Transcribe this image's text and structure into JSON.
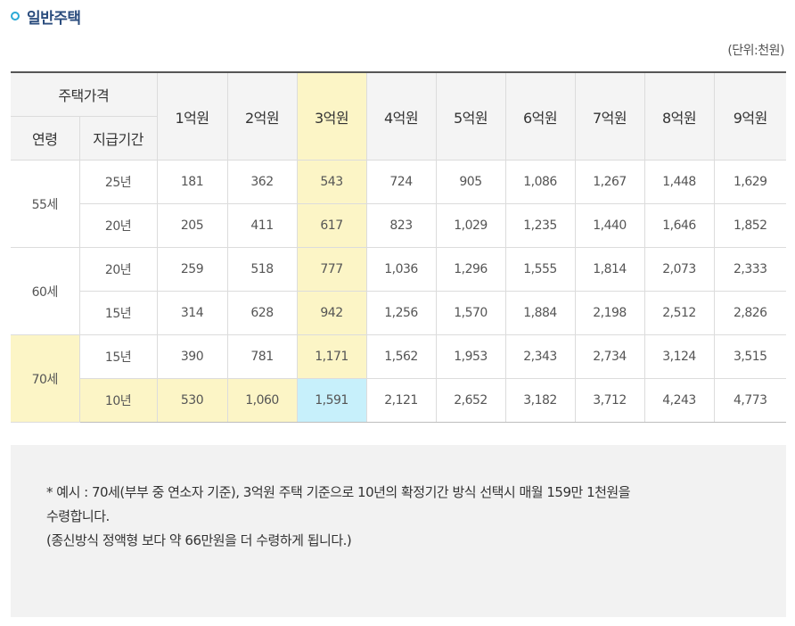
{
  "section": {
    "title": "일반주택",
    "unit": "(단위:천원)"
  },
  "table": {
    "header_price": "주택가격",
    "header_age": "연령",
    "header_period": "지급기간",
    "price_columns": [
      "1억원",
      "2억원",
      "3억원",
      "4억원",
      "5억원",
      "6억원",
      "7억원",
      "8억원",
      "9억원"
    ],
    "age_groups": [
      {
        "age": "55세",
        "rows": [
          {
            "period": "25년",
            "values": [
              "181",
              "362",
              "543",
              "724",
              "905",
              "1,086",
              "1,267",
              "1,448",
              "1,629"
            ]
          },
          {
            "period": "20년",
            "values": [
              "205",
              "411",
              "617",
              "823",
              "1,029",
              "1,235",
              "1,440",
              "1,646",
              "1,852"
            ]
          }
        ]
      },
      {
        "age": "60세",
        "rows": [
          {
            "period": "20년",
            "values": [
              "259",
              "518",
              "777",
              "1,036",
              "1,296",
              "1,555",
              "1,814",
              "2,073",
              "2,333"
            ]
          },
          {
            "period": "15년",
            "values": [
              "314",
              "628",
              "942",
              "1,256",
              "1,570",
              "1,884",
              "2,198",
              "2,512",
              "2,826"
            ]
          }
        ]
      },
      {
        "age": "70세",
        "rows": [
          {
            "period": "15년",
            "values": [
              "390",
              "781",
              "1,171",
              "1,562",
              "1,953",
              "2,343",
              "2,734",
              "3,124",
              "3,515"
            ]
          },
          {
            "period": "10년",
            "values": [
              "530",
              "1,060",
              "1,591",
              "2,121",
              "2,652",
              "3,182",
              "3,712",
              "4,243",
              "4,773"
            ]
          }
        ]
      }
    ]
  },
  "note": {
    "line1": "* 예시 : 70세(부부 중 연소자 기준), 3억원 주택 기준으로 10년의 확정기간 방식 선택시 매월 159만 1천원을",
    "line2": "수령합니다.",
    "line3": "(종신방식 정액형 보다 약 66만원을 더 수령하게 됩니다.)"
  },
  "colors": {
    "title": "#2b4d7e",
    "bullet": "#2aa9d6",
    "highlight_yellow": "#fcf5c6",
    "highlight_blue": "#c7f0fb",
    "header_bg": "#f4f4f4",
    "note_bg": "#f2f2f2"
  }
}
